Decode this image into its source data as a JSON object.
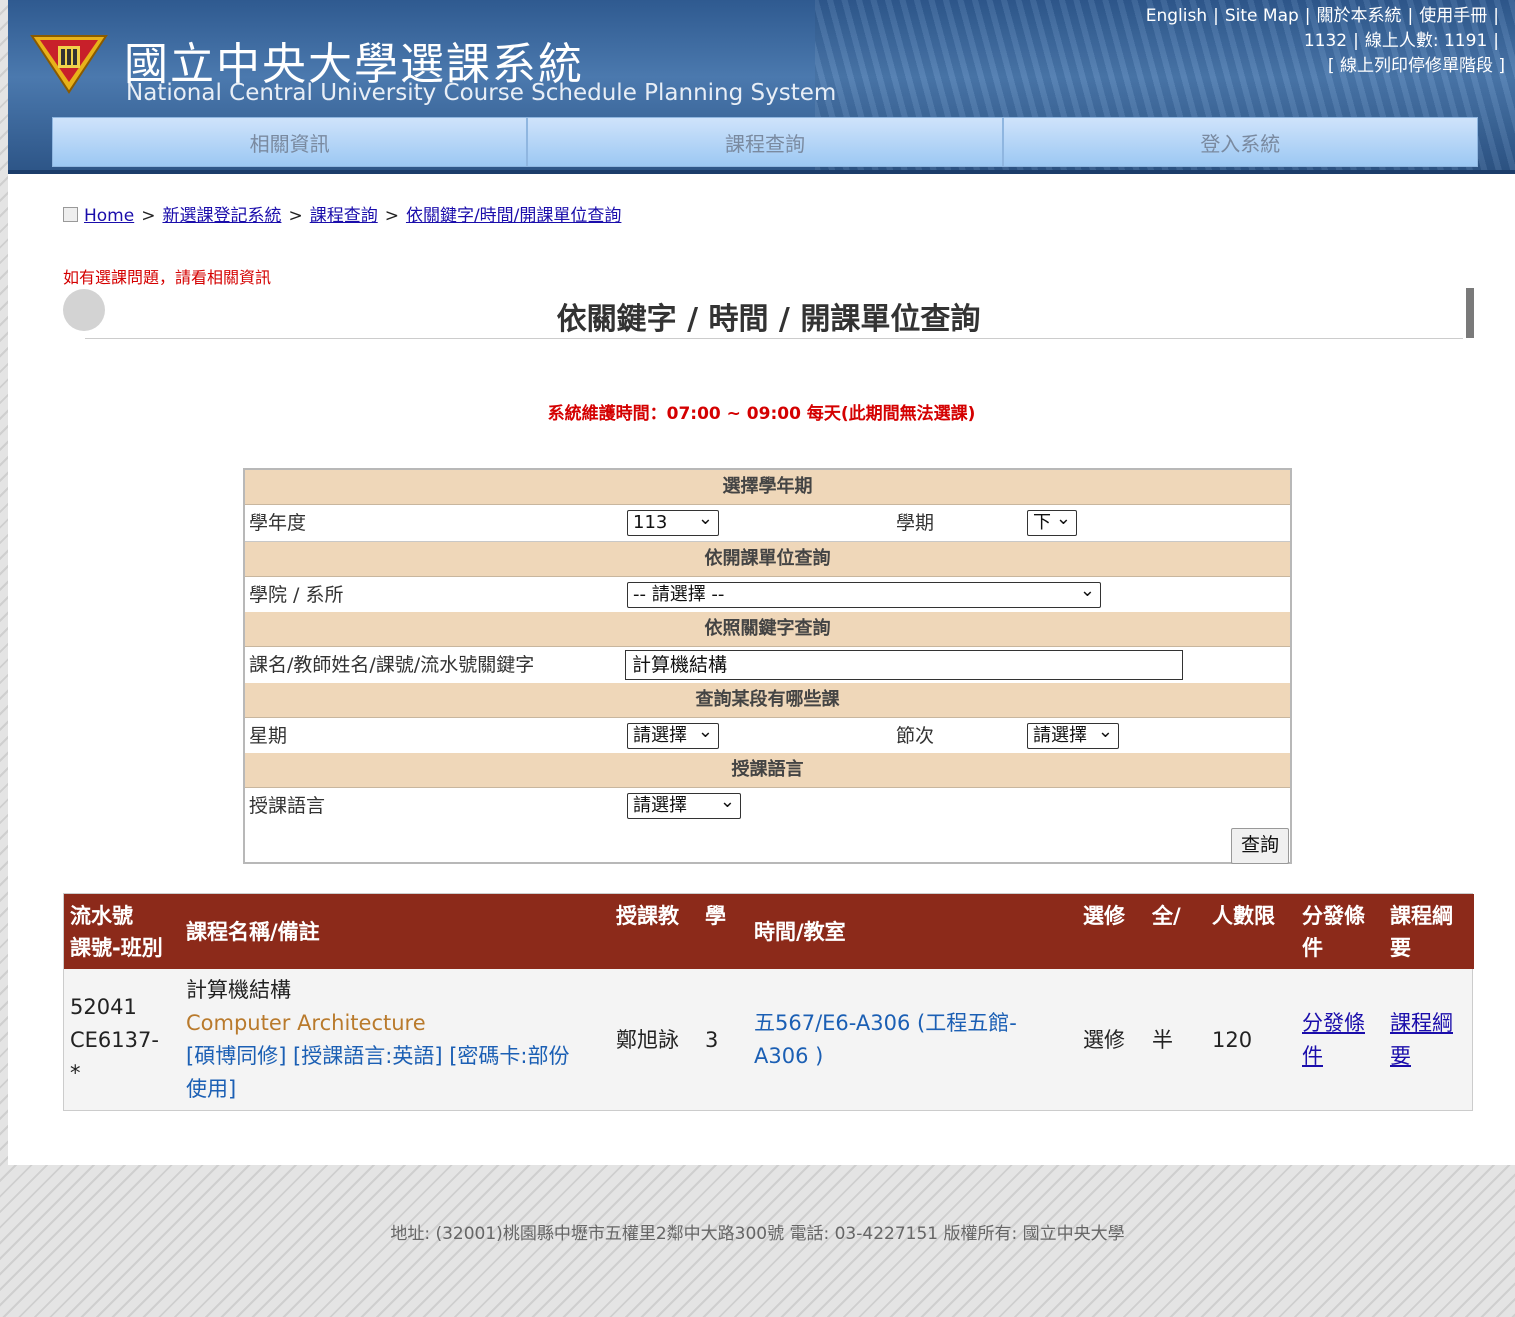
{
  "header": {
    "title_zh": "國立中央大學選課系統",
    "title_en": "National Central University Course Schedule Planning System",
    "links": {
      "english": "English",
      "site_map": "Site Map",
      "about": "關於本系統",
      "manual": "使用手冊"
    },
    "semester": "1132",
    "online_label": "線上人數: 1191",
    "stage": "[ 線上列印停修單階段 ]"
  },
  "nav": {
    "info": "相關資訊",
    "query": "課程查詢",
    "login": "登入系統"
  },
  "breadcrumb": {
    "home": "Home",
    "system": "新選課登記系統",
    "query": "課程查詢",
    "current": "依關鍵字/時間/開課單位查詢"
  },
  "notice": "如有選課問題，請看相關資訊",
  "section_title": "依關鍵字 / 時間 / 開課單位查詢",
  "maintenance": "系統維護時間：07:00 ~ 09:00 每天(此期間無法選課)",
  "form": {
    "semester_head": "選擇學年期",
    "year_label": "學年度",
    "year_value": "113",
    "term_label": "學期",
    "term_value": "下",
    "dept_head": "依開課單位查詢",
    "dept_label": "學院 / 系所",
    "dept_value": "-- 請選擇 --",
    "keyword_head": "依照關鍵字查詢",
    "keyword_label": "課名/教師姓名/課號/流水號關鍵字",
    "keyword_value": "計算機結構",
    "time_head": "查詢某段有哪些課",
    "day_label": "星期",
    "day_value": "請選擇",
    "period_label": "節次",
    "period_value": "請選擇",
    "lang_head": "授課語言",
    "lang_label": "授課語言",
    "lang_value": "請選擇",
    "query_button": "查詢"
  },
  "results": {
    "headers": {
      "serial": "流水號",
      "serial2": "課號-班別",
      "name": "課程名稱/備註",
      "teacher": "授課教師",
      "credit": "學分",
      "time": "時間/教室",
      "type": "選修別",
      "half": "全/半",
      "limit": "人數限制",
      "condition": "分發條件",
      "outline": "課程綱要"
    },
    "rows": [
      {
        "serial": "52041",
        "code": "CE6137-",
        "class": "*",
        "name_zh": "計算機結構",
        "name_en": "Computer Architecture",
        "info1": "[碩博同修] [授課語言:英語] [密碼卡:部份",
        "info2": "使用]",
        "teacher": "鄭旭詠",
        "credit": "3",
        "time_room1": "五567/E6-A306 (工程五館-",
        "time_room2": "A306 )",
        "type": "選修",
        "half": "半",
        "limit": "120",
        "condition1": "分發條",
        "condition2": "件",
        "outline1": "課程綱",
        "outline2": "要"
      }
    ]
  },
  "footer": "地址: (32001)桃園縣中壢市五權里2鄰中大路300號 電話: 03-4227151 版權所有: 國立中央大學",
  "colors": {
    "header_blue": "#3b6aa0",
    "nav_blue": "#a8d0f6",
    "form_head": "#efd7b9",
    "table_head": "#8c2a1a",
    "notice_red": "#d40000"
  }
}
